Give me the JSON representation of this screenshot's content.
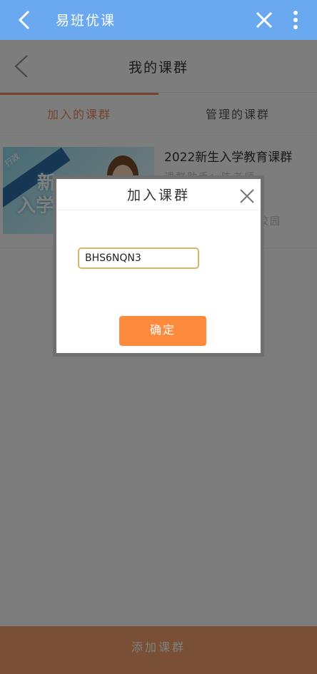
{
  "appbar": {
    "title": "易班优课",
    "back_icon": "chevron-left-icon",
    "close_icon": "close-icon",
    "more_icon": "more-vertical-icon",
    "background": "#6aa8ef"
  },
  "page": {
    "title": "我的课群",
    "tabs": [
      {
        "label": "加入的课群",
        "active": true
      },
      {
        "label": "管理的课群",
        "active": false
      }
    ],
    "course": {
      "title": "2022新生入学教育课群",
      "subtitle": "课群助手：陈老师",
      "meta": "公、校园",
      "thumb_tag": "行政",
      "thumb_text_1": "新",
      "thumb_text_2": "入学"
    },
    "bottom_button": "添加课群",
    "accent": "#f0875a"
  },
  "dialog": {
    "title": "加入课群",
    "code_value": "BHS6NQN3",
    "confirm_label": "确定",
    "confirm_color": "#fe8a3b",
    "input_border_color": "#d9b763"
  }
}
